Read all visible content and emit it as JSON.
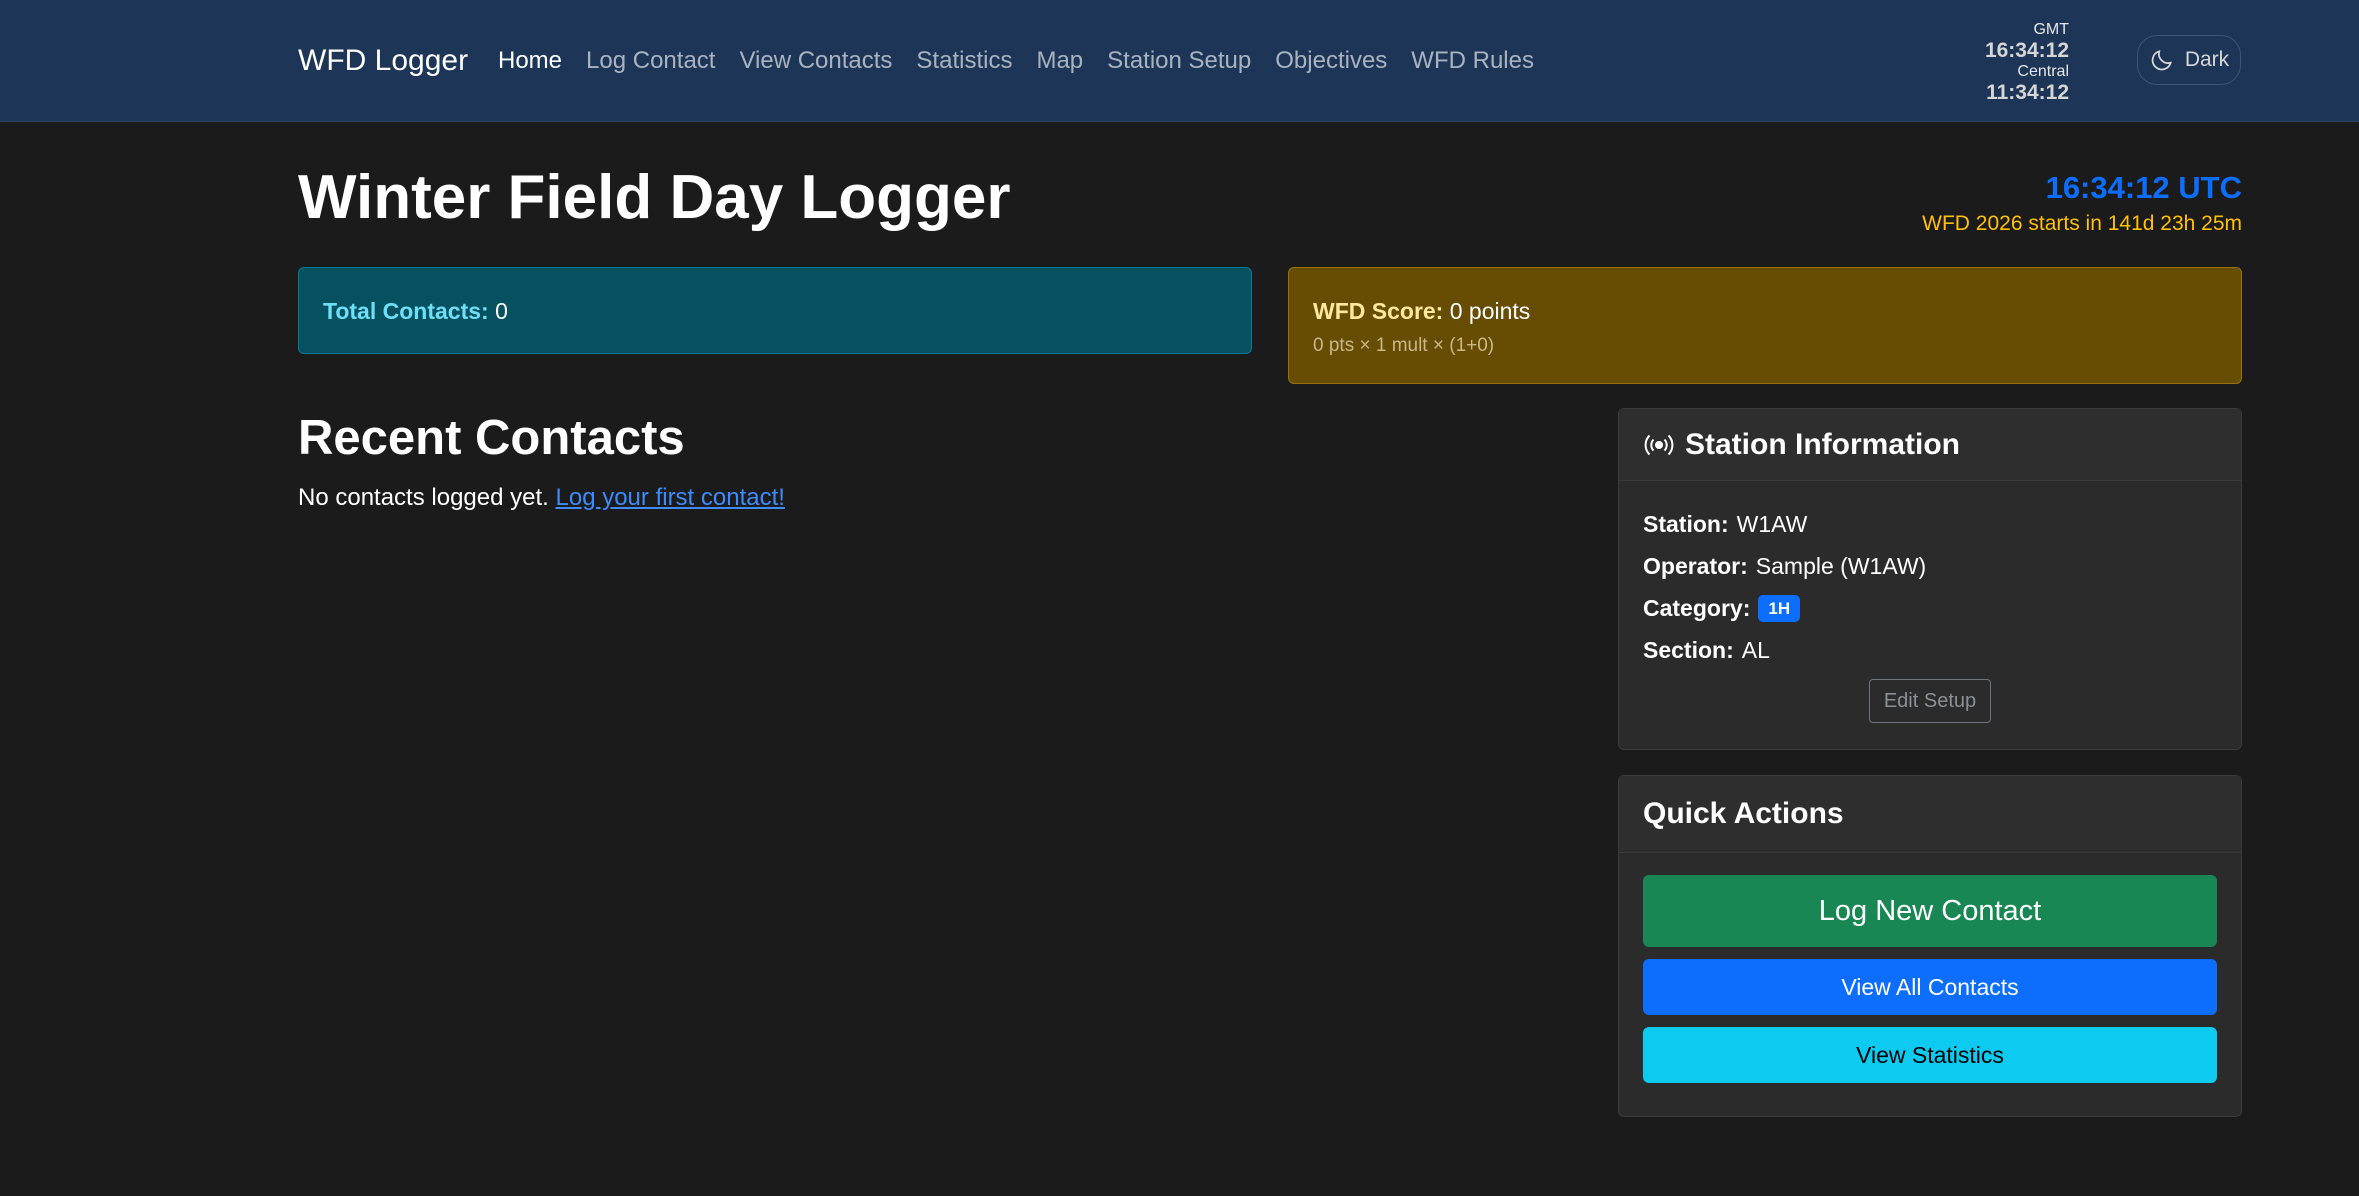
{
  "navbar": {
    "brand": "WFD Logger",
    "links": [
      {
        "label": "Home",
        "active": true
      },
      {
        "label": "Log Contact"
      },
      {
        "label": "View Contacts"
      },
      {
        "label": "Statistics"
      },
      {
        "label": "Map"
      },
      {
        "label": "Station Setup"
      },
      {
        "label": "Objectives"
      },
      {
        "label": "WFD Rules"
      }
    ],
    "clocks": [
      {
        "zone": "GMT",
        "time": "16:34:12"
      },
      {
        "zone": "Central",
        "time": "11:34:12"
      }
    ],
    "theme_toggle": {
      "label": "Dark",
      "icon": "moon-icon"
    }
  },
  "header": {
    "title": "Winter Field Day Logger",
    "utc_clock": "16:34:12 UTC",
    "countdown": "WFD 2026 starts in 141d 23h 25m"
  },
  "alerts": {
    "total_contacts": {
      "label": "Total Contacts:",
      "value": "0"
    },
    "wfd_score": {
      "label": "WFD Score:",
      "value": "0 points",
      "detail": "0 pts × 1 mult × (1+0)"
    }
  },
  "recent": {
    "title": "Recent Contacts",
    "empty_text": "No contacts logged yet.",
    "empty_link": "Log your first contact!"
  },
  "station_info": {
    "title": "Station Information",
    "icon": "broadcast-icon",
    "station": {
      "label": "Station:",
      "value": "W1AW"
    },
    "operator": {
      "label": "Operator:",
      "value": "Sample (W1AW)"
    },
    "category": {
      "label": "Category:",
      "value": "1H"
    },
    "section": {
      "label": "Section:",
      "value": "AL"
    },
    "edit_button": "Edit Setup"
  },
  "quick_actions": {
    "title": "Quick Actions",
    "log_new": "Log New Contact",
    "view_all": "View All Contacts",
    "view_stats": "View Statistics"
  },
  "colors": {
    "navbar_bg": "#1d3557",
    "page_bg": "#1b1b1b",
    "primary": "#0d6efd",
    "success": "#198754",
    "info": "#0dcaf0",
    "warning": "#ffc107"
  }
}
